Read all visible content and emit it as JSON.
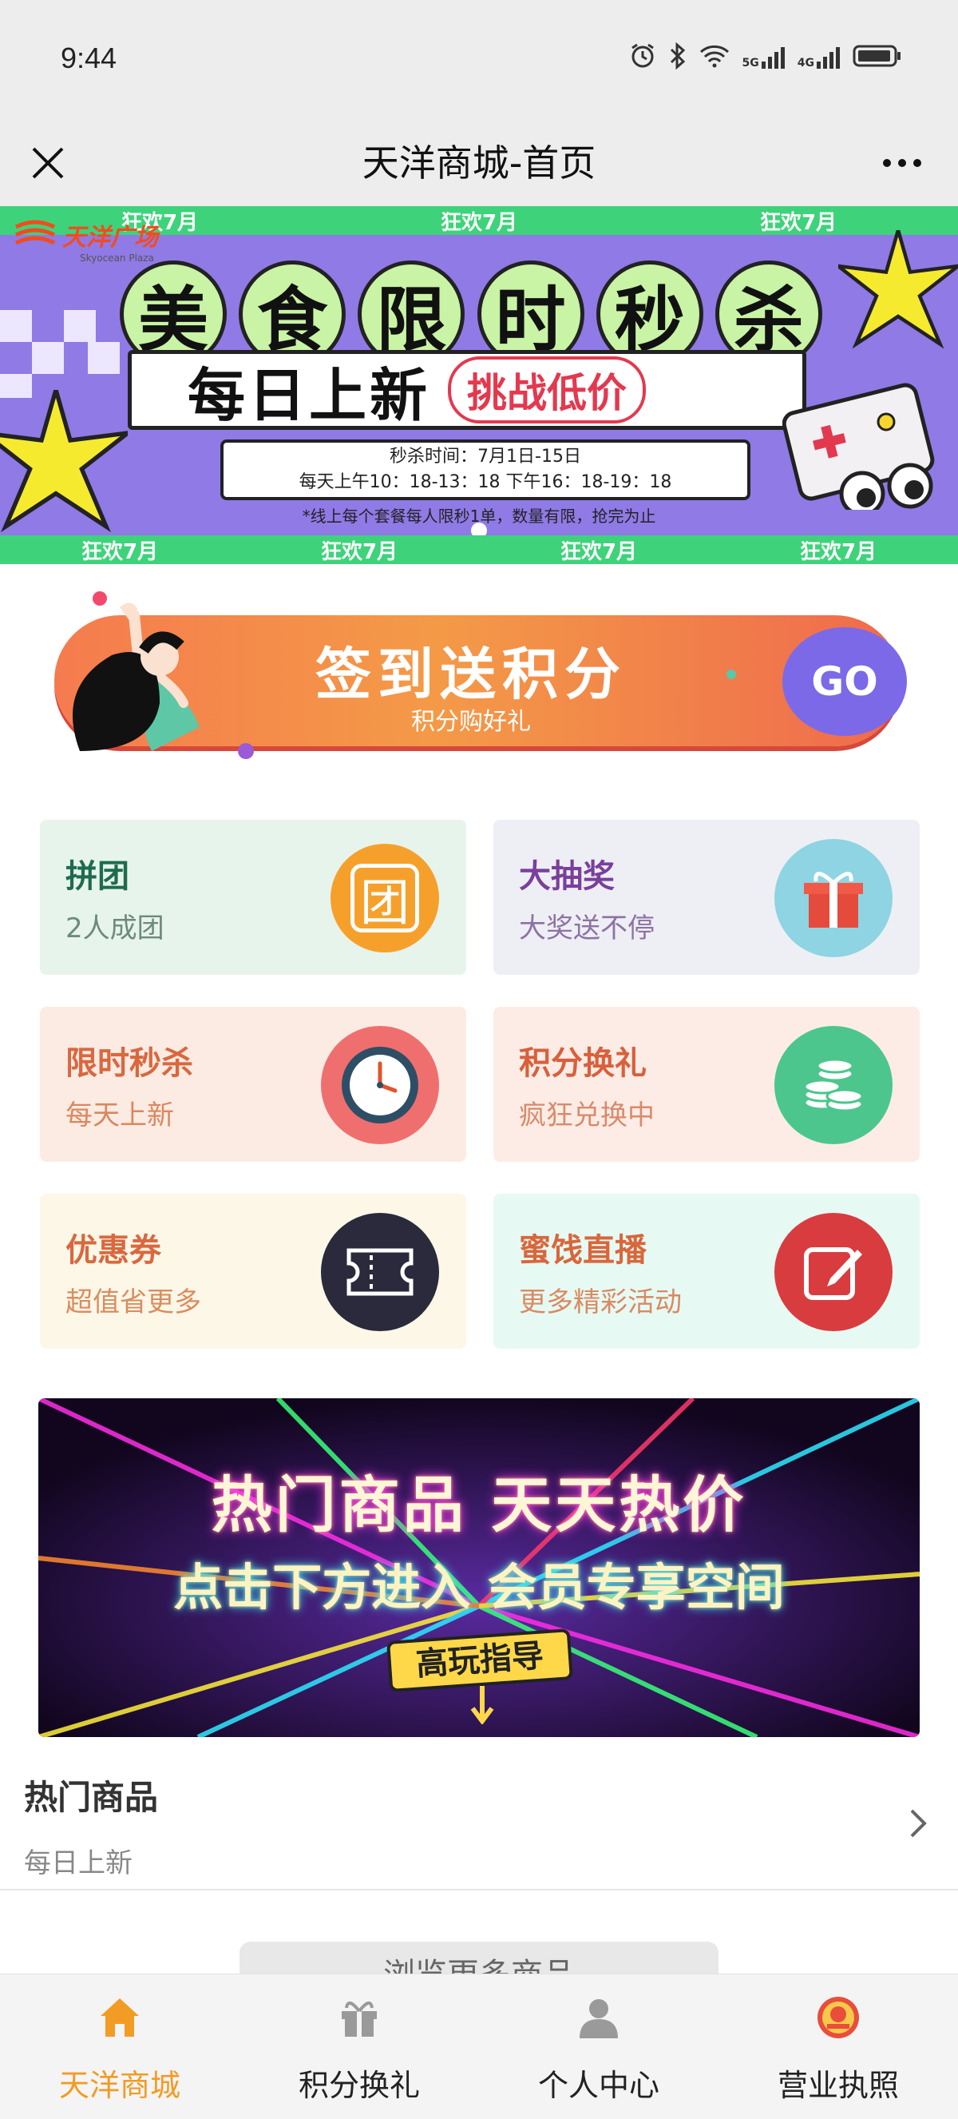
{
  "status_bar": {
    "time": "9:44",
    "network_5g": "5G",
    "network_4g": "4G"
  },
  "header": {
    "title": "天洋商城-首页"
  },
  "hero": {
    "strip_label": "狂欢7月",
    "logo_text": "天洋广场",
    "logo_sub": "Skyocean Plaza",
    "headline_chars": [
      "美",
      "食",
      "限",
      "时",
      "秒",
      "杀"
    ],
    "daily_new": "每日上新",
    "challenge": "挑战低价",
    "time_line1": "秒杀时间：7月1日-15日",
    "time_line2": "每天上午10：18-13：18 下午16：18-19：18",
    "note": "*线上每个套餐每人限秒1单，数量有限，抢完为止"
  },
  "signin": {
    "title": "签到送积分",
    "subtitle": "积分购好礼",
    "go_label": "GO"
  },
  "cards": [
    {
      "title": "拼团",
      "subtitle": "2人成团",
      "icon": "group-icon",
      "icon_glyph": "团",
      "bg": "#e7f4ec",
      "title_color": "#1f6b4f",
      "sub_color": "#6e8a7c",
      "icon_bg": "#f6a02c"
    },
    {
      "title": "大抽奖",
      "subtitle": "大奖送不停",
      "icon": "gift-icon",
      "bg": "#eeeff5",
      "title_color": "#7a3f9c",
      "sub_color": "#8e72a3",
      "icon_bg": "#8ed4e2"
    },
    {
      "title": "限时秒杀",
      "subtitle": "每天上新",
      "icon": "clock-icon",
      "bg": "#fcebe3",
      "title_color": "#d9683f",
      "sub_color": "#d9885e",
      "icon_bg": "#ef6f6f"
    },
    {
      "title": "积分换礼",
      "subtitle": "疯狂兑换中",
      "icon": "coins-icon",
      "bg": "#fdece6",
      "title_color": "#d8603c",
      "sub_color": "#d98a6b",
      "icon_bg": "#4cc68c"
    },
    {
      "title": "优惠券",
      "subtitle": "超值省更多",
      "icon": "ticket-icon",
      "bg": "#fdf7e8",
      "title_color": "#d8693f",
      "sub_color": "#d98d5f",
      "icon_bg": "#2b2a3c"
    },
    {
      "title": "蜜饯直播",
      "subtitle": "更多精彩活动",
      "icon": "edit-icon",
      "bg": "#e6faf3",
      "title_color": "#d8673c",
      "sub_color": "#d98a62",
      "icon_bg": "#d93c3f"
    }
  ],
  "hot_banner": {
    "line1": "热门商品 天天热价",
    "line2": "点击下方进入 会员专享空间",
    "guide": "高玩指导"
  },
  "hot_section": {
    "title": "热门商品",
    "subtitle": "每日上新",
    "browse_more": "浏览更多商品"
  },
  "bottom_nav": [
    {
      "label": "天洋商城",
      "icon": "home-icon",
      "active": true
    },
    {
      "label": "积分换礼",
      "icon": "gift-nav-icon",
      "active": false
    },
    {
      "label": "个人中心",
      "icon": "user-icon",
      "active": false
    },
    {
      "label": "营业执照",
      "icon": "license-emblem-icon",
      "active": false
    }
  ],
  "colors": {
    "accent": "#f29b25",
    "hero_bg": "#8f7ae6",
    "hero_strip": "#3ed37a"
  }
}
